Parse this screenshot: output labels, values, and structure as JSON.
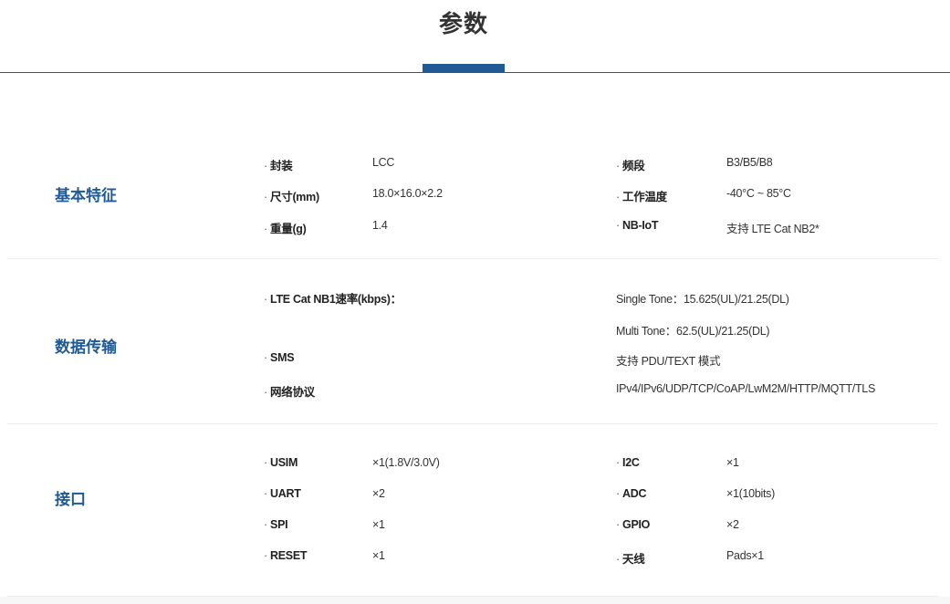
{
  "page": {
    "title": "参数"
  },
  "sections": {
    "basic": {
      "label": "基本特征",
      "rows": [
        {
          "k1": "封装",
          "v1": "LCC",
          "k2": "频段",
          "v2": "B3/B5/B8"
        },
        {
          "k1": "尺寸(mm)",
          "v1": "18.0×16.0×2.2",
          "k2": "工作温度",
          "v2": "-40°C ~ 85°C"
        },
        {
          "k1": "重量(g)",
          "v1": "1.4",
          "k2": "NB-IoT",
          "v2": "支持 LTE Cat NB2*"
        }
      ]
    },
    "data": {
      "label": "数据传输",
      "rate_key": "LTE Cat NB1速率(kbps)：",
      "rate_single": "Single Tone：15.625(UL)/21.25(DL)",
      "rate_multi": "Multi Tone：62.5(UL)/21.25(DL)",
      "sms_key": "SMS",
      "sms_val": "支持 PDU/TEXT 模式",
      "proto_key": "网络协议",
      "proto_val": "IPv4/IPv6/UDP/TCP/CoAP/LwM2M/HTTP/MQTT/TLS"
    },
    "iface": {
      "label": "接口",
      "rows": [
        {
          "k1": "USIM",
          "v1": "×1(1.8V/3.0V)",
          "k2": "I2C",
          "v2": "×1"
        },
        {
          "k1": "UART",
          "v1": "×2",
          "k2": "ADC",
          "v2": "×1(10bits)"
        },
        {
          "k1": "SPI",
          "v1": "×1",
          "k2": "GPIO",
          "v2": "×2"
        },
        {
          "k1": "RESET",
          "v1": "×1",
          "k2": "天线",
          "v2": "Pads×1"
        }
      ]
    }
  }
}
